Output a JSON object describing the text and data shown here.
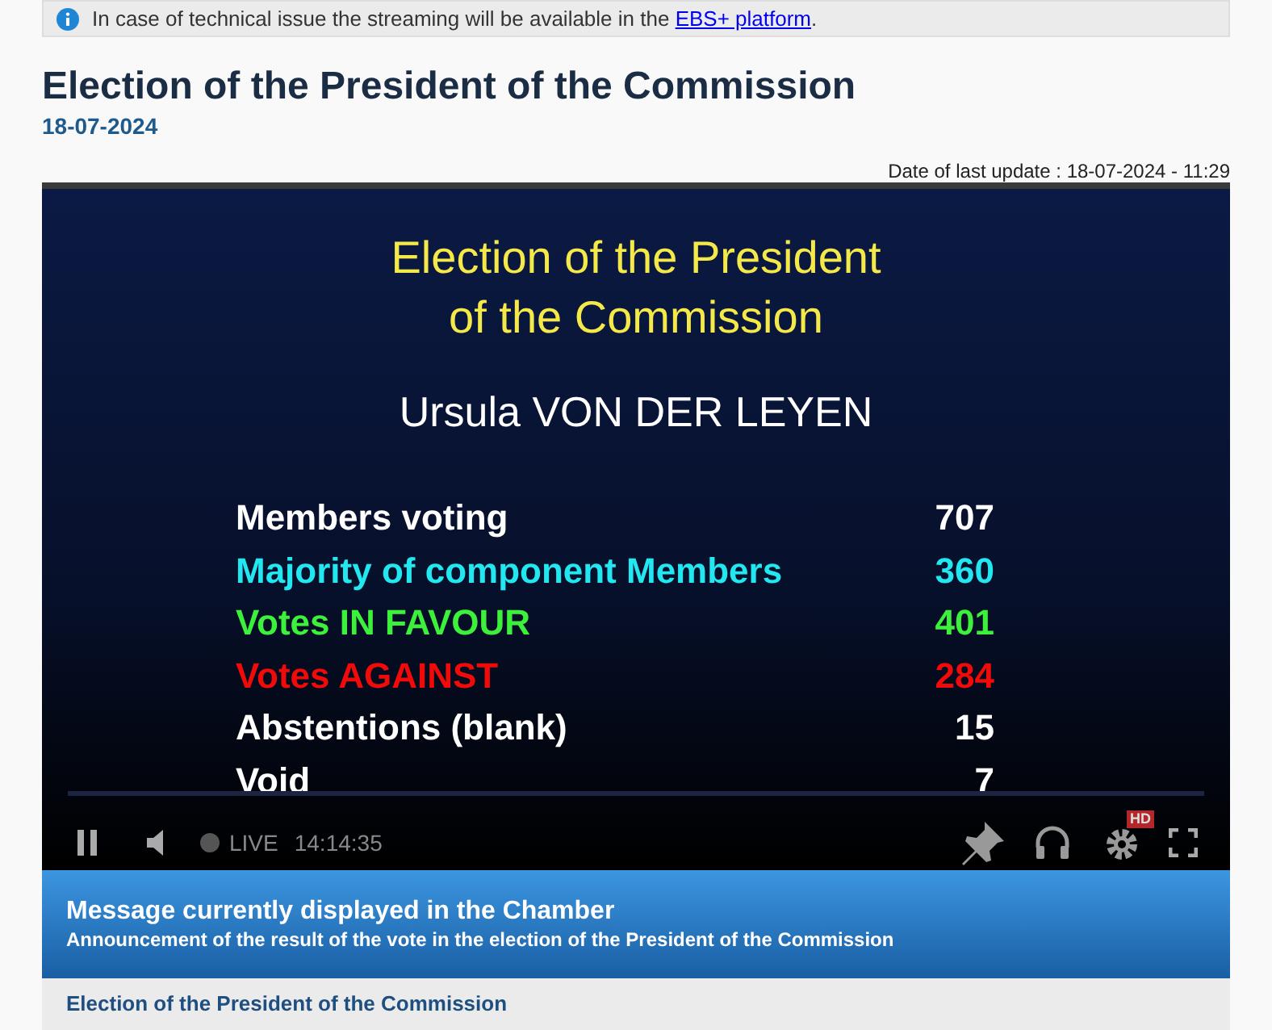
{
  "notice": {
    "text": "In case of technical issue the streaming will be available in the",
    "link": "EBS+ platform",
    "end": "."
  },
  "title": "Election of the President of the Commission",
  "date": "18-07-2024",
  "last_update": "Date of last update : 18-07-2024 - 11:29",
  "video": {
    "slide_title": [
      "Election of the President",
      "of the Commission"
    ],
    "candidate": "Ursula VON DER LEYEN",
    "results": [
      {
        "label": "Members voting",
        "value": "707",
        "color": "#ffffff"
      },
      {
        "label": "Majority of component Members",
        "value": "360",
        "color": "#22e6f0"
      },
      {
        "label": "Votes IN FAVOUR",
        "value": "401",
        "color": "#3cf03c"
      },
      {
        "label": "Votes AGAINST",
        "value": "284",
        "color": "#f00a0a"
      },
      {
        "label": "Abstentions (blank)",
        "value": "15",
        "color": "#ffffff"
      },
      {
        "label": "Void",
        "value": "7",
        "color": "#ffffff"
      }
    ],
    "live_label": "LIVE",
    "time": "14:14:35",
    "hd_badge": "HD"
  },
  "message": {
    "heading": "Message currently displayed in the Chamber",
    "text": "Announcement of the result of the vote in the election of the President of the Commission"
  },
  "next_section": "Election of the President of the Commission"
}
